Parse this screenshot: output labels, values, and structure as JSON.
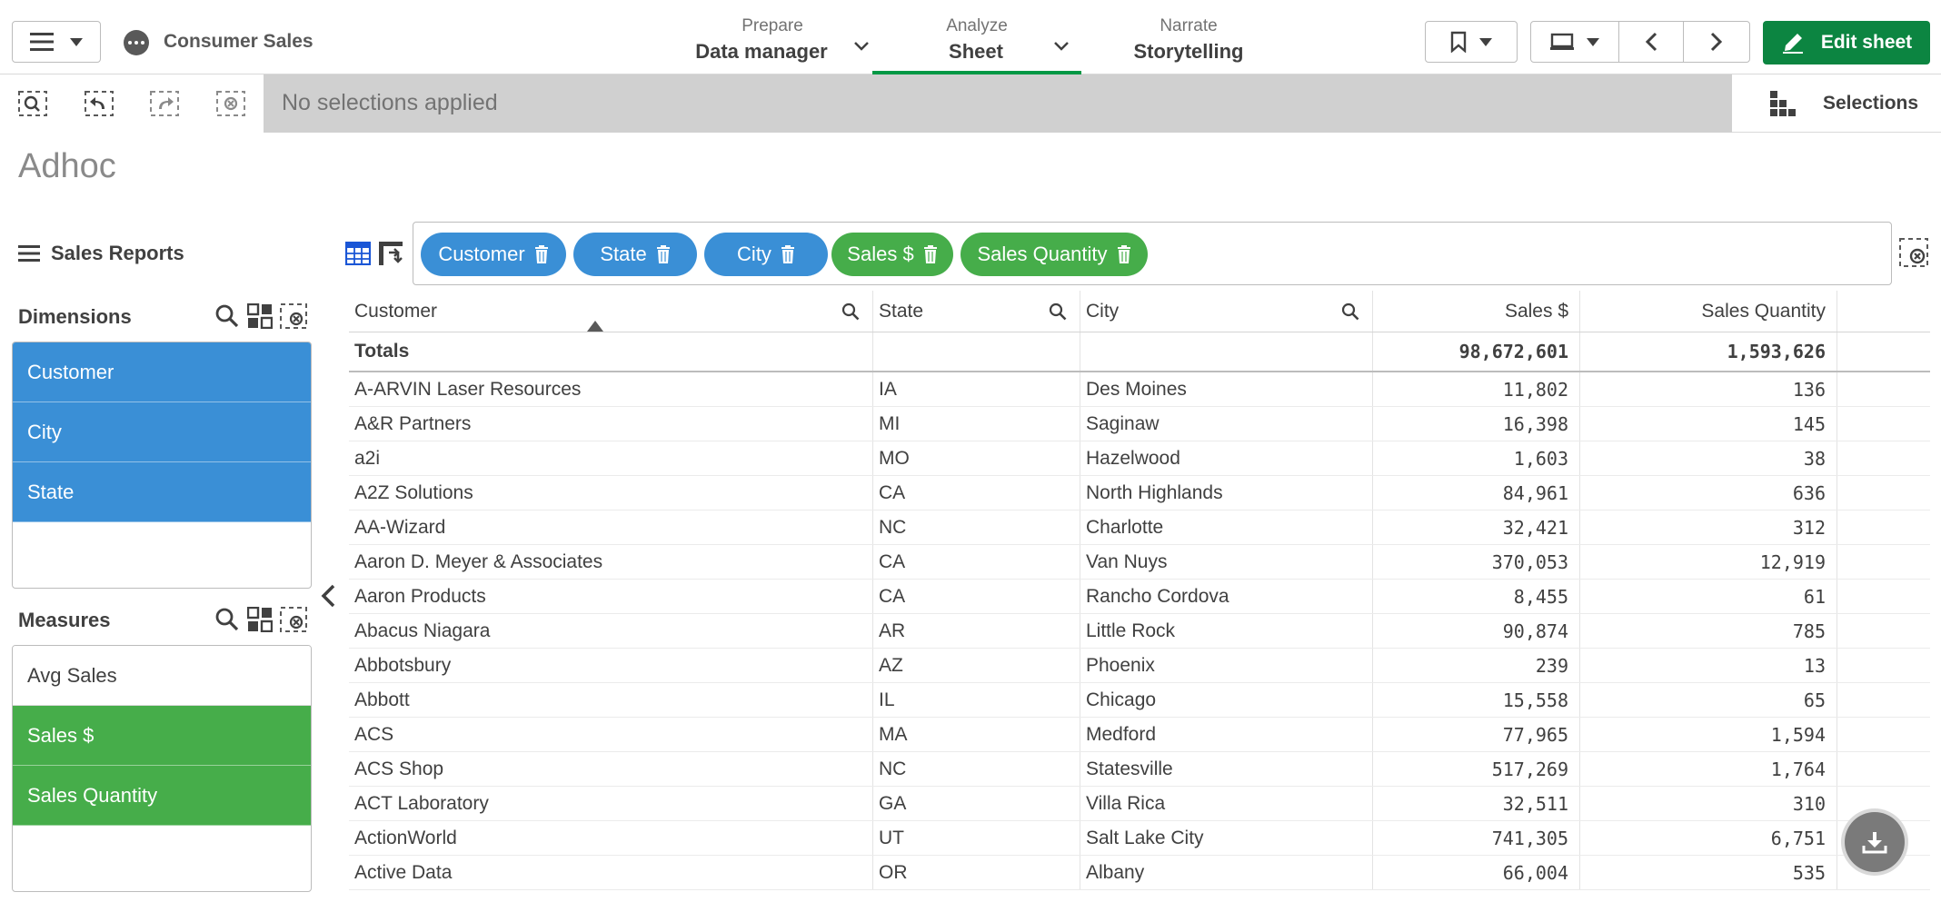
{
  "app": {
    "name": "Consumer Sales"
  },
  "nav": {
    "tabs": [
      {
        "small": "Prepare",
        "big": "Data manager"
      },
      {
        "small": "Analyze",
        "big": "Sheet"
      },
      {
        "small": "Narrate",
        "big": "Storytelling"
      }
    ],
    "edit_label": "Edit sheet",
    "accent": "#009845"
  },
  "selection_bar": {
    "status": "No selections applied",
    "selections_label": "Selections"
  },
  "sheet": {
    "title": "Adhoc"
  },
  "panel": {
    "title": "Sales Reports",
    "dimensions_label": "Dimensions",
    "dimensions": [
      "Customer",
      "City",
      "State"
    ],
    "measures_label": "Measures",
    "measures": [
      "Avg Sales",
      "Sales $",
      "Sales Quantity"
    ]
  },
  "pills": [
    "Customer",
    "State",
    "City",
    "Sales $",
    "Sales Quantity"
  ],
  "table": {
    "headers": [
      "Customer",
      "State",
      "City",
      "Sales $",
      "Sales Quantity"
    ],
    "totals": {
      "label": "Totals",
      "sales": "98,672,601",
      "qty": "1,593,626"
    },
    "rows": [
      [
        "A-ARVIN Laser Resources",
        "IA",
        "Des Moines",
        "11,802",
        "136"
      ],
      [
        "A&R Partners",
        "MI",
        "Saginaw",
        "16,398",
        "145"
      ],
      [
        "a2i",
        "MO",
        "Hazelwood",
        "1,603",
        "38"
      ],
      [
        "A2Z Solutions",
        "CA",
        "North Highlands",
        "84,961",
        "636"
      ],
      [
        "AA-Wizard",
        "NC",
        "Charlotte",
        "32,421",
        "312"
      ],
      [
        "Aaron D. Meyer & Associates",
        "CA",
        "Van Nuys",
        "370,053",
        "12,919"
      ],
      [
        "Aaron Products",
        "CA",
        "Rancho Cordova",
        "8,455",
        "61"
      ],
      [
        "Abacus Niagara",
        "AR",
        "Little Rock",
        "90,874",
        "785"
      ],
      [
        "Abbotsbury",
        "AZ",
        "Phoenix",
        "239",
        "13"
      ],
      [
        "Abbott",
        "IL",
        "Chicago",
        "15,558",
        "65"
      ],
      [
        "ACS",
        "MA",
        "Medford",
        "77,965",
        "1,594"
      ],
      [
        "ACS Shop",
        "NC",
        "Statesville",
        "517,269",
        "1,764"
      ],
      [
        "ACT Laboratory",
        "GA",
        "Villa Rica",
        "32,511",
        "310"
      ],
      [
        "ActionWorld",
        "UT",
        "Salt Lake City",
        "741,305",
        "6,751"
      ],
      [
        "Active Data",
        "OR",
        "Albany",
        "66,004",
        "535"
      ]
    ]
  }
}
